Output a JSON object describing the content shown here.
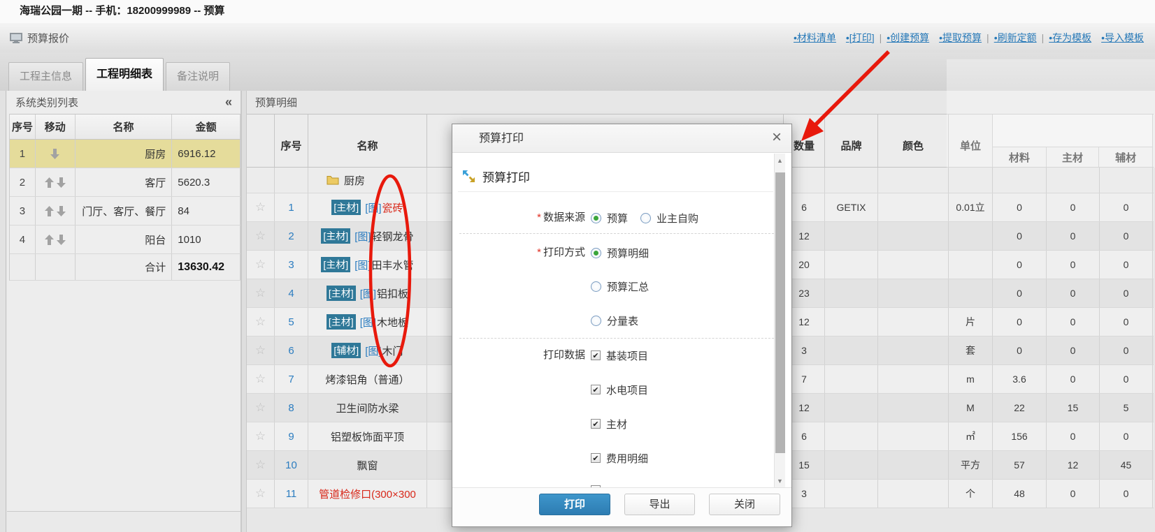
{
  "window_title": "海瑞公园一期 -- 手机：18200999989 -- 预算",
  "toolbar": {
    "title": "预算报价",
    "links": [
      {
        "label": "•材料清单",
        "divider_after": false
      },
      {
        "label": "•[打印]",
        "divider_after": true
      },
      {
        "label": "•创建预算",
        "divider_after": false
      },
      {
        "label": "•提取预算",
        "divider_after": true
      },
      {
        "label": "•刷新定额",
        "divider_after": true
      },
      {
        "label": "•存为模板",
        "divider_after": false
      },
      {
        "label": "•导入模板",
        "divider_after": false
      }
    ]
  },
  "tabs": [
    {
      "label": "工程主信息",
      "active": false
    },
    {
      "label": "工程明细表",
      "active": true
    },
    {
      "label": "备注说明",
      "active": false
    }
  ],
  "left_panel": {
    "title": "系统类别列表",
    "columns": [
      "序号",
      "移动",
      "名称",
      "金额"
    ],
    "rows": [
      {
        "no": "1",
        "move": "down",
        "name": "厨房",
        "amount": "6916.12",
        "highlighted": true
      },
      {
        "no": "2",
        "move": "both",
        "name": "客厅",
        "amount": "5620.3",
        "highlighted": false
      },
      {
        "no": "3",
        "move": "both",
        "name": "门厅、客厅、餐厅",
        "amount": "84",
        "highlighted": false
      },
      {
        "no": "4",
        "move": "both",
        "name": "阳台",
        "amount": "1010",
        "highlighted": false
      }
    ],
    "total_label": "合计",
    "total_amount": "13630.42"
  },
  "main_panel": {
    "title": "预算明细",
    "columns": {
      "no": "序号",
      "name": "名称",
      "qty": "数量",
      "brand": "品牌",
      "color": "颜色",
      "unit": "单位",
      "price_sub": [
        "材料",
        "主材",
        "辅材"
      ]
    },
    "group_row": "厨房",
    "rows": [
      {
        "no": "1",
        "badge": "[主材]",
        "pic": "[图]",
        "name": "瓷砖",
        "name_red": true,
        "qty": "6",
        "brand": "GETIX",
        "color": "",
        "unit": "0.01立",
        "mat": "0",
        "main": "0",
        "aux": "0"
      },
      {
        "no": "2",
        "badge": "[主材]",
        "pic": "[图]",
        "name": "轻钢龙骨",
        "name_red": false,
        "qty": "12",
        "brand": "",
        "color": "",
        "unit": "",
        "mat": "0",
        "main": "0",
        "aux": "0"
      },
      {
        "no": "3",
        "badge": "[主材]",
        "pic": "[图]",
        "name": "田丰水管",
        "name_red": false,
        "qty": "20",
        "brand": "",
        "color": "",
        "unit": "",
        "mat": "0",
        "main": "0",
        "aux": "0"
      },
      {
        "no": "4",
        "badge": "[主材]",
        "pic": "[图]",
        "name": "铝扣板",
        "name_red": false,
        "qty": "23",
        "brand": "",
        "color": "",
        "unit": "",
        "mat": "0",
        "main": "0",
        "aux": "0"
      },
      {
        "no": "5",
        "badge": "[主材]",
        "pic": "[图]",
        "name": "木地板",
        "name_red": false,
        "qty": "12",
        "brand": "",
        "color": "",
        "unit": "片",
        "mat": "0",
        "main": "0",
        "aux": "0"
      },
      {
        "no": "6",
        "badge": "[辅材]",
        "pic": "[图]",
        "name": "木门",
        "name_red": false,
        "qty": "3",
        "brand": "",
        "color": "",
        "unit": "套",
        "mat": "0",
        "main": "0",
        "aux": "0"
      },
      {
        "no": "7",
        "badge": "",
        "pic": "",
        "name": "烤漆铝角（普通）",
        "name_red": false,
        "qty": "7",
        "brand": "",
        "color": "",
        "unit": "m",
        "mat": "3.6",
        "main": "0",
        "aux": "0"
      },
      {
        "no": "8",
        "badge": "",
        "pic": "",
        "name": "卫生间防水梁",
        "name_red": false,
        "qty": "12",
        "brand": "",
        "color": "",
        "unit": "M",
        "mat": "22",
        "main": "15",
        "aux": "5"
      },
      {
        "no": "9",
        "badge": "",
        "pic": "",
        "name": "铝塑板饰面平顶",
        "name_red": false,
        "qty": "6",
        "brand": "",
        "color": "",
        "unit": "㎡",
        "mat": "156",
        "main": "0",
        "aux": "0"
      },
      {
        "no": "10",
        "badge": "",
        "pic": "",
        "name": "飘窗",
        "name_red": false,
        "qty": "15",
        "brand": "",
        "color": "",
        "unit": "平方",
        "mat": "57",
        "main": "12",
        "aux": "45"
      },
      {
        "no": "11",
        "badge": "",
        "pic": "",
        "name": "管道检修口(300×300",
        "name_red": true,
        "qty": "3",
        "brand": "",
        "color": "",
        "unit": "个",
        "mat": "48",
        "main": "0",
        "aux": "0"
      }
    ]
  },
  "modal": {
    "title": "预算打印",
    "heading": "预算打印",
    "sections": [
      {
        "label": "数据来源",
        "required": true,
        "control": "radio",
        "options": [
          {
            "label": "预算",
            "checked": true
          },
          {
            "label": "业主自购",
            "checked": false
          }
        ],
        "layout": "inline"
      },
      {
        "label": "打印方式",
        "required": true,
        "control": "radio",
        "options": [
          {
            "label": "预算明细",
            "checked": true
          },
          {
            "label": "预算汇总",
            "checked": false
          },
          {
            "label": "分量表",
            "checked": false
          }
        ],
        "layout": "stack"
      },
      {
        "label": "打印数据",
        "required": false,
        "control": "checkbox",
        "options": [
          {
            "label": "基装项目",
            "checked": true
          },
          {
            "label": "水电项目",
            "checked": true
          },
          {
            "label": "主材",
            "checked": true
          },
          {
            "label": "费用明细",
            "checked": true
          },
          {
            "label": "",
            "checked": false
          }
        ],
        "layout": "stack"
      }
    ],
    "buttons": [
      {
        "label": "打印",
        "primary": true
      },
      {
        "label": "导出",
        "primary": false
      },
      {
        "label": "关闭",
        "primary": false
      }
    ]
  },
  "icons": {
    "star": "☆",
    "close": "×",
    "collapse": "«",
    "check": "✔",
    "divider": "|",
    "scroll_up": "▲",
    "scroll_down": "▼"
  },
  "colors": {
    "accent_blue": "#2c7dc0",
    "badge_teal": "#2f7898",
    "highlight_row": "#e5dc9b",
    "alert_red": "#d8281a",
    "annotation_red": "#e8190c",
    "primary_button": "#2d7cb2"
  },
  "annotations": {
    "arrow": "red arrow from print link to print dialog",
    "ellipse": "red ellipse around picture-link column"
  }
}
